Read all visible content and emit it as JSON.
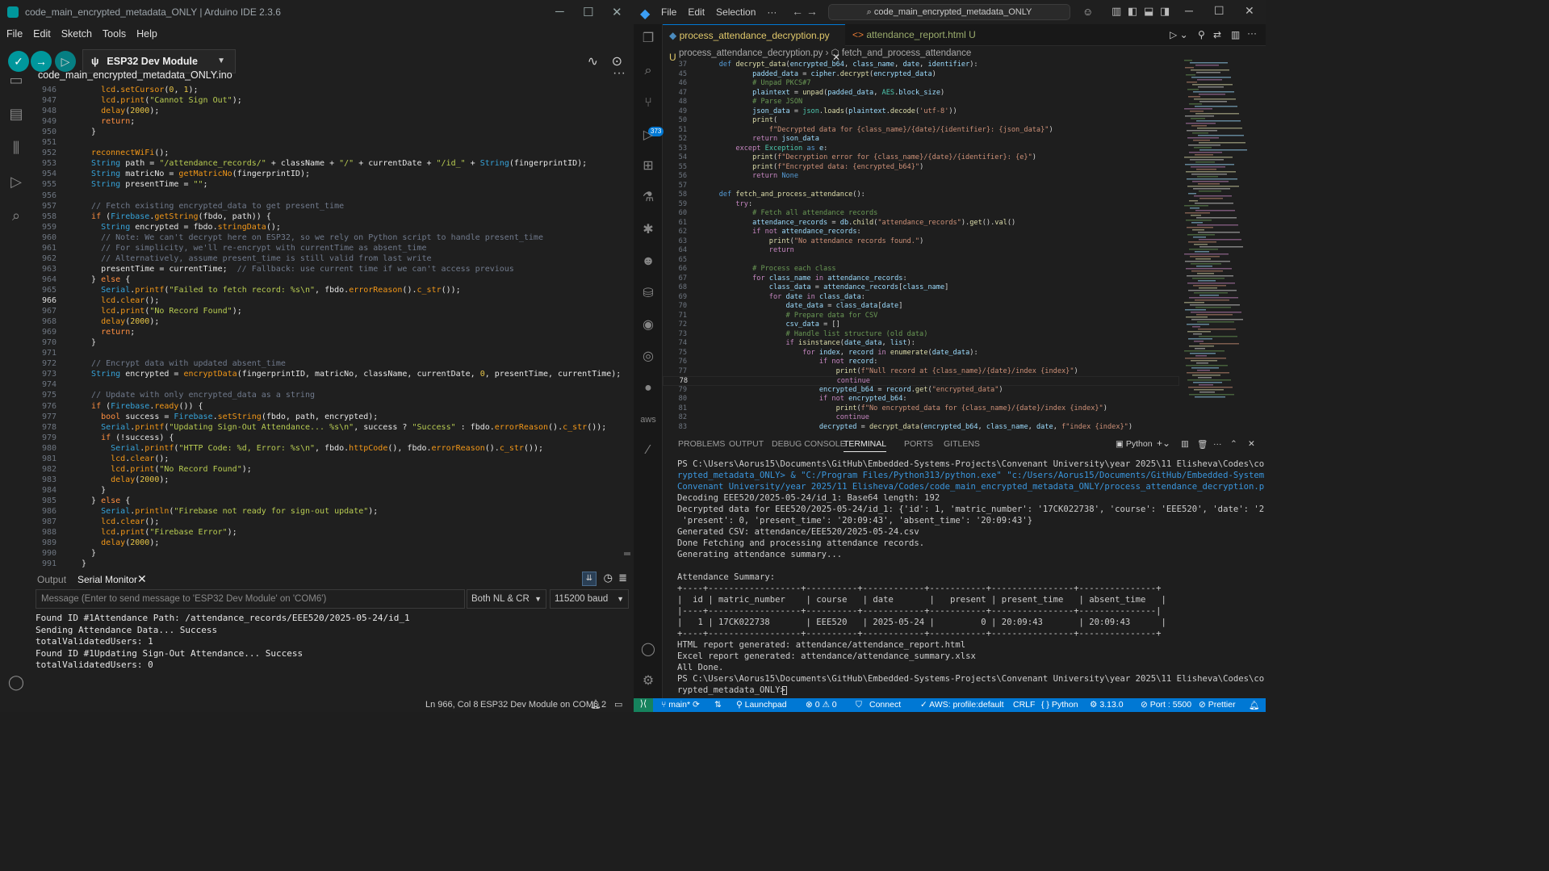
{
  "arduino": {
    "title": "code_main_encrypted_metadata_ONLY | Arduino IDE 2.3.6",
    "window_controls": [
      "─",
      "☐",
      "✕"
    ],
    "menu": [
      "File",
      "Edit",
      "Sketch",
      "Tools",
      "Help"
    ],
    "board": "ESP32 Dev Module",
    "tab": "code_main_encrypted_metadata_ONLY.ino",
    "current_line": "966",
    "lines": [
      [
        "946",
        "    lcd.setCursor(0, 1);"
      ],
      [
        "947",
        "    lcd.print(\"Cannot Sign Out\");"
      ],
      [
        "948",
        "    delay(2000);"
      ],
      [
        "949",
        "    return;"
      ],
      [
        "950",
        "  }"
      ],
      [
        "951",
        ""
      ],
      [
        "952",
        "  reconnectWiFi();"
      ],
      [
        "953",
        "  String path = \"/attendance_records/\" + className + \"/\" + currentDate + \"/id_\" + String(fingerprintID);"
      ],
      [
        "954",
        "  String matricNo = getMatricNo(fingerprintID);"
      ],
      [
        "955",
        "  String presentTime = \"\";"
      ],
      [
        "956",
        ""
      ],
      [
        "957",
        "  // Fetch existing encrypted_data to get present_time"
      ],
      [
        "958",
        "  if (Firebase.getString(fbdo, path)) {"
      ],
      [
        "959",
        "    String encrypted = fbdo.stringData();"
      ],
      [
        "960",
        "    // Note: We can't decrypt here on ESP32, so we rely on Python script to handle present_time"
      ],
      [
        "961",
        "    // For simplicity, we'll re-encrypt with currentTime as absent_time"
      ],
      [
        "962",
        "    // Alternatively, assume present_time is still valid from last write"
      ],
      [
        "963",
        "    presentTime = currentTime;  // Fallback: use current time if we can't access previous"
      ],
      [
        "964",
        "  } else {"
      ],
      [
        "965",
        "    Serial.printf(\"Failed to fetch record: %s\\n\", fbdo.errorReason().c_str());"
      ],
      [
        "966",
        "    lcd.clear();"
      ],
      [
        "967",
        "    lcd.print(\"No Record Found\");"
      ],
      [
        "968",
        "    delay(2000);"
      ],
      [
        "969",
        "    return;"
      ],
      [
        "970",
        "  }"
      ],
      [
        "971",
        ""
      ],
      [
        "972",
        "  // Encrypt data with updated absent_time"
      ],
      [
        "973",
        "  String encrypted = encryptData(fingerprintID, matricNo, className, currentDate, 0, presentTime, currentTime);"
      ],
      [
        "974",
        ""
      ],
      [
        "975",
        "  // Update with only encrypted_data as a string"
      ],
      [
        "976",
        "  if (Firebase.ready()) {"
      ],
      [
        "977",
        "    bool success = Firebase.setString(fbdo, path, encrypted);"
      ],
      [
        "978",
        "    Serial.printf(\"Updating Sign-Out Attendance... %s\\n\", success ? \"Success\" : fbdo.errorReason().c_str());"
      ],
      [
        "979",
        "    if (!success) {"
      ],
      [
        "980",
        "      Serial.printf(\"HTTP Code: %d, Error: %s\\n\", fbdo.httpCode(), fbdo.errorReason().c_str());"
      ],
      [
        "981",
        "      lcd.clear();"
      ],
      [
        "982",
        "      lcd.print(\"No Record Found\");"
      ],
      [
        "983",
        "      delay(2000);"
      ],
      [
        "984",
        "    }"
      ],
      [
        "985",
        "  } else {"
      ],
      [
        "986",
        "    Serial.println(\"Firebase not ready for sign-out update\");"
      ],
      [
        "987",
        "    lcd.clear();"
      ],
      [
        "988",
        "    lcd.print(\"Firebase Error\");"
      ],
      [
        "989",
        "    delay(2000);"
      ],
      [
        "990",
        "  }"
      ],
      [
        "991",
        "}"
      ]
    ],
    "bottom_tabs": {
      "output": "Output",
      "serial": "Serial Monitor"
    },
    "serial_placeholder": "Message (Enter to send message to 'ESP32 Dev Module' on 'COM6')",
    "line_ending": "Both NL & CR",
    "baud": "115200 baud",
    "serial_output": [
      "Found ID #1Attendance Path: /attendance_records/EEE520/2025-05-24/id_1",
      "Sending Attendance Data... Success",
      "totalValidatedUsers: 1",
      "Found ID #1Updating Sign-Out Attendance... Success",
      "totalValidatedUsers: 0"
    ],
    "status": {
      "position": "Ln 966, Col 8",
      "board": "ESP32 Dev Module on COM6",
      "notifications": "2"
    }
  },
  "vscode": {
    "menu": [
      "File",
      "Edit",
      "Selection",
      "···"
    ],
    "search": "code_main_encrypted_metadata_ONLY",
    "badge": "373",
    "tabs": [
      {
        "label": "process_attendance_decryption.py",
        "state": "U",
        "color": "#e0c86a"
      },
      {
        "label": "attendance_report.html",
        "state": "U",
        "color": "#9aab6c"
      }
    ],
    "breadcrumb": [
      "process_attendance_decryption.py",
      "fetch_and_process_attendance"
    ],
    "current_line": "78",
    "lines": [
      [
        "37",
        "    def decrypt_data(encrypted_b64, class_name, date, identifier):"
      ],
      [
        "45",
        "            padded_data = cipher.decrypt(encrypted_data)"
      ],
      [
        "46",
        "            # Unpad PKCS#7"
      ],
      [
        "47",
        "            plaintext = unpad(padded_data, AES.block_size)"
      ],
      [
        "48",
        "            # Parse JSON"
      ],
      [
        "49",
        "            json_data = json.loads(plaintext.decode('utf-8'))"
      ],
      [
        "50",
        "            print("
      ],
      [
        "51",
        "                f\"Decrypted data for {class_name}/{date}/{identifier}: {json_data}\")"
      ],
      [
        "52",
        "            return json_data"
      ],
      [
        "53",
        "        except Exception as e:"
      ],
      [
        "54",
        "            print(f\"Decryption error for {class_name}/{date}/{identifier}: {e}\")"
      ],
      [
        "55",
        "            print(f\"Encrypted data: {encrypted_b64}\")"
      ],
      [
        "56",
        "            return None"
      ],
      [
        "57",
        ""
      ],
      [
        "58",
        "    def fetch_and_process_attendance():"
      ],
      [
        "59",
        "        try:"
      ],
      [
        "60",
        "            # Fetch all attendance records"
      ],
      [
        "61",
        "            attendance_records = db.child(\"attendance_records\").get().val()"
      ],
      [
        "62",
        "            if not attendance_records:"
      ],
      [
        "63",
        "                print(\"No attendance records found.\")"
      ],
      [
        "64",
        "                return"
      ],
      [
        "65",
        ""
      ],
      [
        "66",
        "            # Process each class"
      ],
      [
        "67",
        "            for class_name in attendance_records:"
      ],
      [
        "68",
        "                class_data = attendance_records[class_name]"
      ],
      [
        "69",
        "                for date in class_data:"
      ],
      [
        "70",
        "                    date_data = class_data[date]"
      ],
      [
        "71",
        "                    # Prepare data for CSV"
      ],
      [
        "72",
        "                    csv_data = []"
      ],
      [
        "73",
        "                    # Handle list structure (old data)"
      ],
      [
        "74",
        "                    if isinstance(date_data, list):"
      ],
      [
        "75",
        "                        for index, record in enumerate(date_data):"
      ],
      [
        "76",
        "                            if not record:"
      ],
      [
        "77",
        "                                print(f\"Null record at {class_name}/{date}/index {index}\")"
      ],
      [
        "78",
        "                                continue"
      ],
      [
        "79",
        "                            encrypted_b64 = record.get(\"encrypted_data\")"
      ],
      [
        "80",
        "                            if not encrypted_b64:"
      ],
      [
        "81",
        "                                print(f\"No encrypted_data for {class_name}/{date}/index {index}\")"
      ],
      [
        "82",
        "                                continue"
      ],
      [
        "83",
        "                            decrypted = decrypt_data(encrypted_b64, class_name, date, f\"index {index}\")"
      ]
    ],
    "panel_tabs": [
      "PROBLEMS",
      "OUTPUT",
      "DEBUG CONSOLE",
      "TERMINAL",
      "PORTS",
      "GITLENS"
    ],
    "terminal_profile": "Python",
    "terminal": [
      "PS C:\\Users\\Aorus15\\Documents\\GitHub\\Embedded-Systems-Projects\\Convenant University\\year 2025\\11 Elisheva\\Codes\\code_main_enc",
      "rypted_metadata_ONLY> & \"C:/Program Files/Python313/python.exe\" \"c:/Users/Aorus15/Documents/GitHub/Embedded-Systems-Projects/",
      "Convenant University/year 2025/11 Elisheva/Codes/code_main_encrypted_metadata_ONLY/process_attendance_decryption.py\"",
      "Decoding EEE520/2025-05-24/id_1: Base64 length: 192",
      "Decrypted data for EEE520/2025-05-24/id_1: {'id': 1, 'matric_number': '17CK022738', 'course': 'EEE520', 'date': '2025-05-24',",
      " 'present': 0, 'present_time': '20:09:43', 'absent_time': '20:09:43'}",
      "Generated CSV: attendance/EEE520/2025-05-24.csv",
      "Done Fetching and processing attendance records.",
      "Generating attendance summary...",
      "",
      "Attendance Summary:",
      "+----+------------------+----------+------------+-----------+----------------+---------------+",
      "|  id | matric_number    | course   | date       |   present | present_time   | absent_time   |",
      "|----+------------------+----------+------------+-----------+----------------+---------------|",
      "|   1 | 17CK022738       | EEE520   | 2025-05-24 |         0 | 20:09:43       | 20:09:43      |",
      "+----+------------------+----------+------------+-----------+----------------+---------------+",
      "HTML report generated: attendance/attendance_report.html",
      "Excel report generated: attendance/attendance_summary.xlsx",
      "All Done.",
      "PS C:\\Users\\Aorus15\\Documents\\GitHub\\Embedded-Systems-Projects\\Convenant University\\year 2025\\11 Elisheva\\Codes\\code_main_enc",
      "rypted_metadata_ONLY> "
    ],
    "status": {
      "branch": "main*",
      "launchpad": "Launchpad",
      "problems": "⊗ 0 ⚠ 0",
      "connect": "Connect",
      "aws": "AWS: profile:default",
      "eol": "CRLF",
      "lang": "Python",
      "version": "3.13.0",
      "port": "Port : 5500",
      "prettier": "Prettier"
    }
  }
}
